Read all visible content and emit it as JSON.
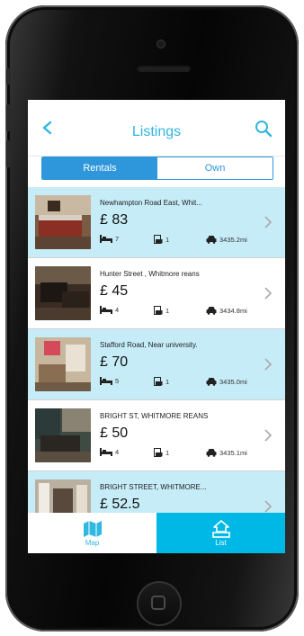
{
  "nav": {
    "title": "Listings",
    "back_icon": "chevron-left-icon",
    "search_icon": "search-icon"
  },
  "segments": [
    {
      "label": "Rentals",
      "selected": true
    },
    {
      "label": "Own",
      "selected": false
    }
  ],
  "listings": [
    {
      "address": "Newhampton Road East, Whit...",
      "price": "£ 83",
      "beds": "7",
      "baths": "1",
      "distance": "3435.2mi"
    },
    {
      "address": "Hunter Street , Whitmore reans",
      "price": "£ 45",
      "beds": "4",
      "baths": "1",
      "distance": "3434.8mi"
    },
    {
      "address": "Stafford Road, Near university.",
      "price": "£ 70",
      "beds": "5",
      "baths": "1",
      "distance": "3435.0mi"
    },
    {
      "address": "BRIGHT ST, WHITMORE REANS",
      "price": "£ 50",
      "beds": "4",
      "baths": "1",
      "distance": "3435.1mi"
    },
    {
      "address": "BRIGHT STREET, WHITMORE...",
      "price": "£ 52.5",
      "beds": "",
      "baths": "",
      "distance": ""
    }
  ],
  "tabs": [
    {
      "label": "Map",
      "icon": "map-icon",
      "active": false
    },
    {
      "label": "List",
      "icon": "list-house-icon",
      "active": true
    }
  ],
  "colors": {
    "accent": "#31b6de",
    "segment": "#2e97dc",
    "row_highlight": "#c6ecf8",
    "tab_active": "#00b8e6"
  }
}
